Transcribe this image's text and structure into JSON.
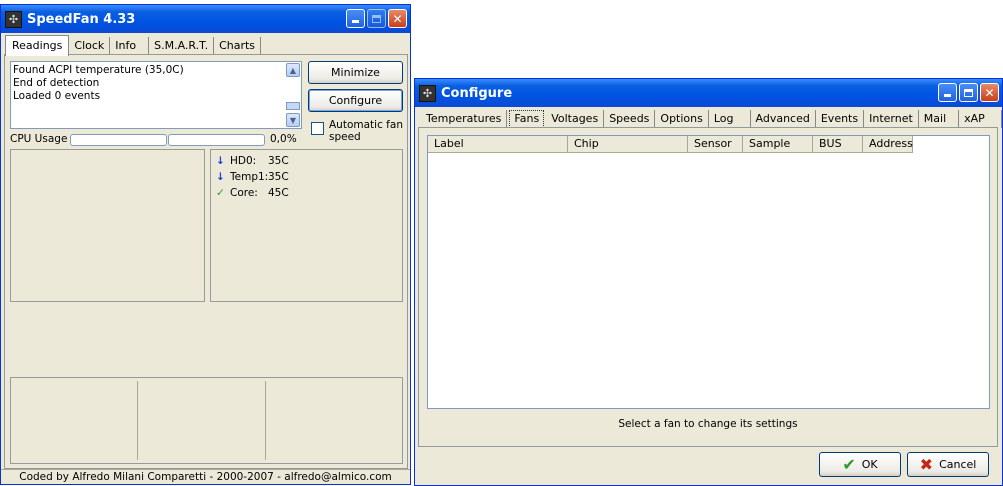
{
  "speedfan": {
    "title": "SpeedFan 4.33",
    "tabs": [
      "Readings",
      "Clock",
      "Info",
      "S.M.A.R.T.",
      "Charts"
    ],
    "log_lines": [
      "Found ACPI temperature (35,0C)",
      "End of detection",
      "Loaded 0 events"
    ],
    "minimize_label": "Minimize",
    "configure_label": "Configure",
    "auto_fan_label": "Automatic fan speed",
    "auto_fan_checked": false,
    "cpu_usage_label": "CPU Usage",
    "cpu_usage_value": "0,0%",
    "temps": [
      {
        "icon": "arrow-down-icon",
        "name": "HD0:",
        "value": "35C"
      },
      {
        "icon": "arrow-down-icon",
        "name": "Temp1:",
        "value": "35C"
      },
      {
        "icon": "check-icon",
        "name": "Core:",
        "value": "45C"
      }
    ],
    "footer": "Coded by Alfredo Milani Comparetti - 2000-2007 - alfredo@almico.com"
  },
  "configure": {
    "title": "Configure",
    "tabs": [
      "Temperatures",
      "Fans",
      "Voltages",
      "Speeds",
      "Options",
      "Log",
      "Advanced",
      "Events",
      "Internet",
      "Mail",
      "xAP"
    ],
    "active_tab": "Fans",
    "columns": [
      "Label",
      "Chip",
      "Sensor",
      "Sample",
      "BUS",
      "Address"
    ],
    "hint": "Select a fan to change its settings",
    "ok_label": "OK",
    "cancel_label": "Cancel"
  },
  "colors": {
    "titlebar": "#0054e3",
    "window_bg": "#ece9d8",
    "ok_check": "#2b9a2b",
    "cancel_x": "#c0281a",
    "arrow_blue": "#1a3fd0"
  }
}
